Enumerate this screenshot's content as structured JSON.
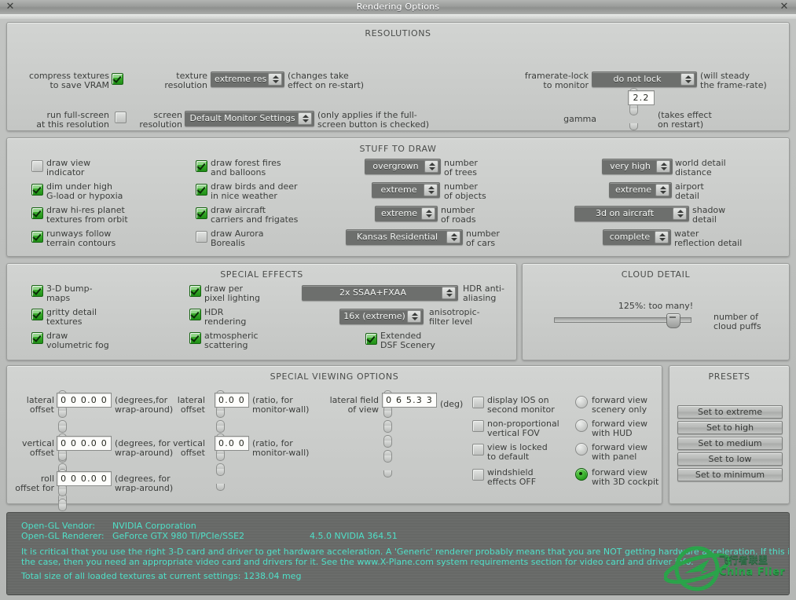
{
  "window": {
    "title": "Rendering Options",
    "close_left": "✕",
    "close_right": "✕"
  },
  "resolutions": {
    "title": "RESOLUTIONS",
    "compress_textures_label": "compress textures\nto save VRAM",
    "compress_textures_checked": true,
    "texture_resolution_label": "texture\nresolution",
    "texture_resolution_value": "extreme res!",
    "texture_resolution_note": "(changes take\neffect on re-start)",
    "framerate_lock_label": "framerate-lock\nto monitor",
    "framerate_lock_value": "do not lock",
    "framerate_lock_note": "(will steady\nthe frame-rate)",
    "full_screen_label": "run full-screen\nat this resolution",
    "full_screen_checked": false,
    "screen_resolution_label": "screen\nresolution",
    "screen_resolution_value": "Default Monitor Settings",
    "screen_resolution_note": "(only applies if the full-\nscreen button is checked)",
    "gamma_label": "gamma",
    "gamma_value": "2.2",
    "gamma_note": "(takes effect\non restart)"
  },
  "stuff_to_draw": {
    "title": "STUFF TO DRAW",
    "checks_col1": [
      {
        "label": "draw view\nindicator",
        "checked": false
      },
      {
        "label": "dim under high\nG-load or hypoxia",
        "checked": true
      },
      {
        "label": "draw hi-res planet\ntextures from orbit",
        "checked": true
      },
      {
        "label": "runways follow\nterrain contours",
        "checked": true
      }
    ],
    "checks_col2": [
      {
        "label": "draw forest fires\nand balloons",
        "checked": true
      },
      {
        "label": "draw birds and deer\nin nice weather",
        "checked": true
      },
      {
        "label": "draw aircraft\ncarriers and frigates",
        "checked": true
      },
      {
        "label": "draw Aurora\nBorealis",
        "checked": false
      }
    ],
    "dropdowns_mid": [
      {
        "value": "overgrown",
        "label": "number\nof trees"
      },
      {
        "value": "extreme",
        "label": "number\nof objects"
      },
      {
        "value": "extreme",
        "label": "number\nof roads"
      },
      {
        "value": "Kansas Residential",
        "label": "number\nof cars"
      }
    ],
    "dropdowns_right": [
      {
        "value": "very high",
        "label": "world detail\ndistance"
      },
      {
        "value": "extreme",
        "label": "airport\ndetail"
      },
      {
        "value": "3d on aircraft",
        "label": "shadow\ndetail"
      },
      {
        "value": "complete",
        "label": "water\nreflection detail"
      }
    ]
  },
  "special_effects": {
    "title": "SPECIAL EFFECTS",
    "checks_col1": [
      {
        "label": "3-D bump-\nmaps",
        "checked": true
      },
      {
        "label": "gritty detail\ntextures",
        "checked": true
      },
      {
        "label": "draw\nvolumetric fog",
        "checked": true
      }
    ],
    "checks_col2": [
      {
        "label": "draw per\npixel lighting",
        "checked": true
      },
      {
        "label": "HDR\nrendering",
        "checked": true
      },
      {
        "label": "atmospheric\nscattering",
        "checked": true
      }
    ],
    "hdr_aa_value": "2x SSAA+FXAA",
    "hdr_aa_label": "HDR anti-\naliasing",
    "aniso_value": "16x (extreme)",
    "aniso_label": "anisotropic-\nfilter level",
    "extended_dsf_label": "Extended\nDSF Scenery",
    "extended_dsf_checked": true
  },
  "cloud_detail": {
    "title": "CLOUD DETAIL",
    "slider_readout": "125%: too many!",
    "slider_percent": 125,
    "slider_position_pct": 82,
    "slider_label": "number of\ncloud puffs"
  },
  "special_viewing": {
    "title": "SPECIAL VIEWING OPTIONS",
    "spinners": [
      {
        "label": "lateral\noffset",
        "value": "0 0 0.0 0",
        "digits": 5,
        "note": "(degrees,for\nwrap-around)"
      },
      {
        "label": "vertical\noffset",
        "value": "0 0 0.0 0",
        "digits": 5,
        "note": "(degrees, for\nwrap-around)"
      },
      {
        "label": "roll\noffset for",
        "value": "0 0 0.0 0",
        "digits": 5,
        "note": "(degrees, for\nwrap-around)"
      },
      {
        "label": "lateral\noffset",
        "value": "0.0 0",
        "digits": 3,
        "note": "(ratio, for\nmonitor-wall)"
      },
      {
        "label": "vertical\noffset",
        "value": "0.0 0",
        "digits": 3,
        "note": "(ratio, for\nmonitor-wall)"
      },
      {
        "label": "lateral field\nof view",
        "value": "0 6 5.3 3",
        "digits": 5,
        "note": "(deg)"
      }
    ],
    "checks": [
      {
        "label": "display IOS on\nsecond monitor",
        "checked": false
      },
      {
        "label": "non-proportional\nvertical FOV",
        "checked": false
      },
      {
        "label": "view is locked\nto default",
        "checked": false
      },
      {
        "label": "windshield\neffects OFF",
        "checked": false
      }
    ],
    "radios": [
      {
        "label": "forward view\nscenery only",
        "selected": false
      },
      {
        "label": "forward view\nwith HUD",
        "selected": false
      },
      {
        "label": "forward view\nwith panel",
        "selected": false
      },
      {
        "label": "forward view\nwith 3D cockpit",
        "selected": true
      }
    ]
  },
  "presets": {
    "title": "PRESETS",
    "buttons": [
      "Set to extreme",
      "Set to high",
      "Set to medium",
      "Set to low",
      "Set to minimum"
    ]
  },
  "info": {
    "vendor_label": "Open-GL Vendor:",
    "vendor_value": "NVIDIA Corporation",
    "renderer_label": "Open-GL Renderer:",
    "renderer_value": "GeForce GTX 980 Ti/PCIe/SSE2",
    "gl_version": "4.5.0 NVIDIA 364.51",
    "warning_line1": "It is critical that you use the right 3-D card and driver to get hardware acceleration. A 'Generic' renderer probably means that you are NOT getting hardware acceleration. If this is",
    "warning_line2": "the case, then you need an appropriate video card and drivers for it. See the www.X-Plane.com system requirements section for video card and driver info.",
    "textures_line": "Total size of all loaded textures at current settings: 1238.04 meg"
  },
  "watermark": {
    "line1": "飞行者联盟",
    "line2": "China Flier",
    "accent": "#2aa34a"
  }
}
